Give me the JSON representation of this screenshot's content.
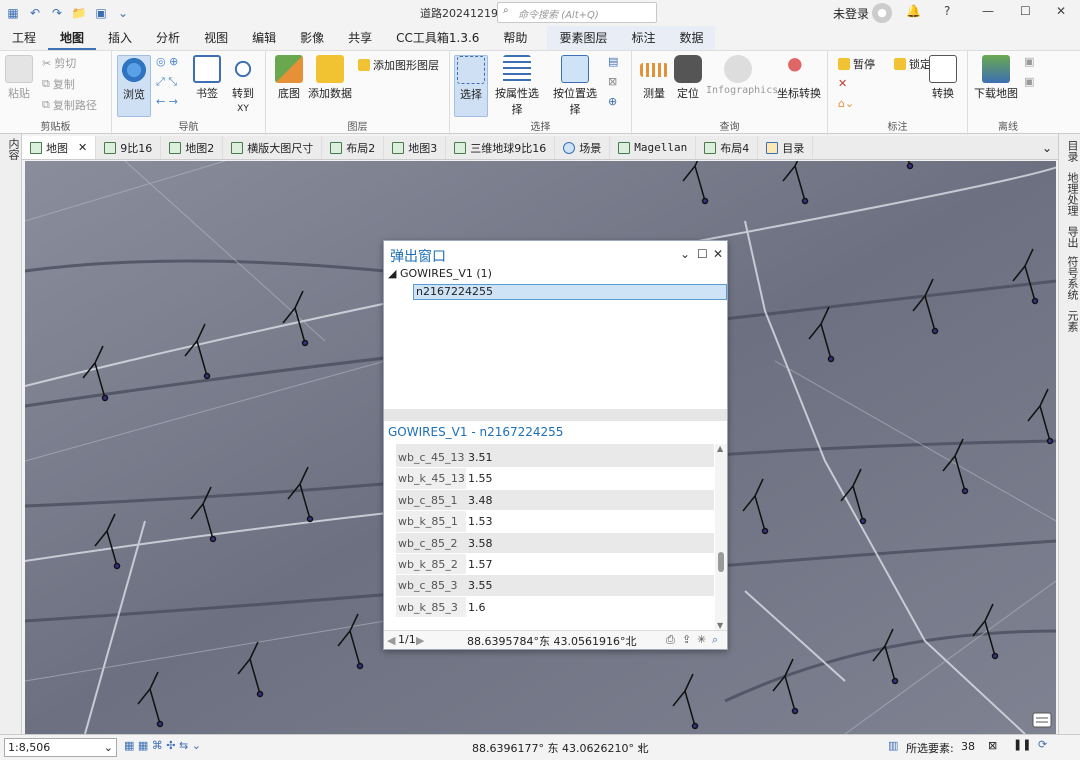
{
  "titlebar": {
    "doc_title": "道路20241219",
    "search_placeholder": "命令搜索 (Alt+Q)",
    "user": "未登录",
    "help": "?"
  },
  "menu": {
    "tabs": [
      "工程",
      "地图",
      "插入",
      "分析",
      "视图",
      "编辑",
      "影像",
      "共享",
      "CC工具箱1.3.6",
      "帮助"
    ],
    "active": "地图",
    "context_tabs": [
      "要素图层",
      "标注",
      "数据"
    ]
  },
  "ribbon": {
    "clipboard": {
      "label": "剪贴板",
      "paste": "粘贴",
      "cut": "剪切",
      "copy": "复制",
      "copy_path": "复制路径"
    },
    "navigate": {
      "label": "导航",
      "explore": "浏览",
      "bookmarks": "书签",
      "goto": "转到",
      "goto_sub": "XY"
    },
    "layer": {
      "label": "图层",
      "basemap": "底图",
      "add_data": "添加数据",
      "add_graphics": "添加图形图层"
    },
    "selection": {
      "label": "选择",
      "select": "选择",
      "by_attr": "按属性选择",
      "by_loc": "按位置选择"
    },
    "inquiry": {
      "label": "查询",
      "measure": "测量",
      "locate": "定位",
      "infographics": "Infographics",
      "coord": "坐标转换"
    },
    "labeling": {
      "label": "标注",
      "pause": "暂停",
      "lock": "锁定",
      "convert": "转换"
    },
    "offline": {
      "label": "离线",
      "download": "下载地图"
    }
  },
  "view_tabs": [
    "地图",
    "9比16",
    "地图2",
    "横版大图尺寸",
    "布局2",
    "地图3",
    "三维地球9比16",
    "场景",
    "Magellan",
    "布局4",
    "目录"
  ],
  "left_pane": "内容",
  "right_pane": [
    "目录",
    "地理处理",
    "导出",
    "符号系统",
    "元素"
  ],
  "popup": {
    "title": "弹出窗口",
    "layer": "GOWIRES_V1",
    "count": "(1)",
    "feature": "n2167224255",
    "feature_title": "GOWIRES_V1 - n2167224255",
    "rows": [
      {
        "k": "wb_c_45_13",
        "v": "3.51"
      },
      {
        "k": "wb_k_45_13",
        "v": "1.55"
      },
      {
        "k": "wb_c_85_1",
        "v": "3.48"
      },
      {
        "k": "wb_k_85_1",
        "v": "1.53"
      },
      {
        "k": "wb_c_85_2",
        "v": "3.58"
      },
      {
        "k": "wb_k_85_2",
        "v": "1.57"
      },
      {
        "k": "wb_c_85_3",
        "v": "3.55"
      },
      {
        "k": "wb_k_85_3",
        "v": "1.6"
      }
    ],
    "page": "1/1",
    "coords": "88.6395784°东 43.0561916°北"
  },
  "status": {
    "scale": "1:8,506",
    "coords": "88.6396177° 东 43.0626210° 北",
    "selected_label": "所选要素:",
    "selected_count": "38"
  }
}
